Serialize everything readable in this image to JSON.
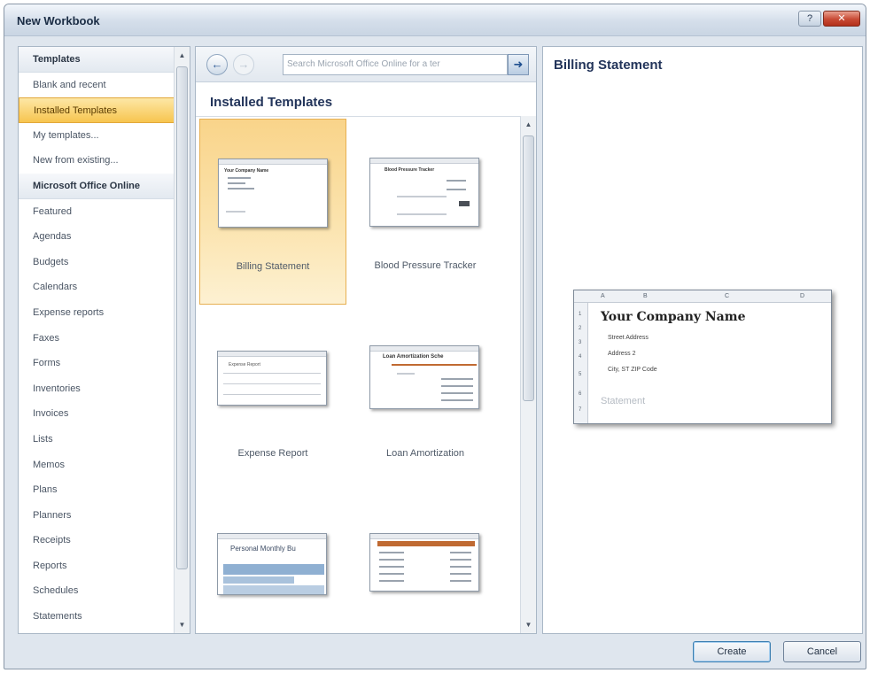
{
  "window": {
    "title": "New Workbook",
    "controls": {
      "help": "?",
      "close": "✕"
    }
  },
  "sidebar": {
    "items": [
      {
        "label": "Templates",
        "kind": "header"
      },
      {
        "label": "Blank and recent",
        "kind": "item"
      },
      {
        "label": "Installed Templates",
        "kind": "selected"
      },
      {
        "label": "My templates...",
        "kind": "item"
      },
      {
        "label": "New from existing...",
        "kind": "item"
      },
      {
        "label": "Microsoft Office Online",
        "kind": "header"
      },
      {
        "label": "Featured",
        "kind": "item"
      },
      {
        "label": "Agendas",
        "kind": "item"
      },
      {
        "label": "Budgets",
        "kind": "item"
      },
      {
        "label": "Calendars",
        "kind": "item"
      },
      {
        "label": "Expense reports",
        "kind": "item"
      },
      {
        "label": "Faxes",
        "kind": "item"
      },
      {
        "label": "Forms",
        "kind": "item"
      },
      {
        "label": "Inventories",
        "kind": "item"
      },
      {
        "label": "Invoices",
        "kind": "item"
      },
      {
        "label": "Lists",
        "kind": "item"
      },
      {
        "label": "Memos",
        "kind": "item"
      },
      {
        "label": "Plans",
        "kind": "item"
      },
      {
        "label": "Planners",
        "kind": "item"
      },
      {
        "label": "Receipts",
        "kind": "item"
      },
      {
        "label": "Reports",
        "kind": "item"
      },
      {
        "label": "Schedules",
        "kind": "item"
      },
      {
        "label": "Statements",
        "kind": "item"
      }
    ]
  },
  "nav": {
    "back_icon": "←",
    "forward_icon": "→",
    "search_placeholder": "Search Microsoft Office Online for a ter",
    "go_icon": "➜"
  },
  "gallery": {
    "title": "Installed Templates",
    "templates": [
      {
        "label": "Billing Statement",
        "thumb_title": "Your Company Name",
        "selected": true
      },
      {
        "label": "Blood Pressure Tracker",
        "thumb_title": "Blood Pressure Tracker",
        "selected": false
      },
      {
        "label": "Expense Report",
        "thumb_title": "Expense Report",
        "selected": false
      },
      {
        "label": "Loan Amortization",
        "thumb_title": "Loan Amortization Sche",
        "selected": false
      },
      {
        "label": "",
        "thumb_title": "Personal Monthly Bu",
        "selected": false
      },
      {
        "label": "",
        "thumb_title": "",
        "selected": false
      }
    ]
  },
  "preview": {
    "title": "Billing Statement",
    "columns": [
      "A",
      "B",
      "C",
      "D"
    ],
    "rows": [
      "1",
      "2",
      "3",
      "4",
      "5",
      "6",
      "7"
    ],
    "company": "Your Company Name",
    "lines": [
      "Street Address",
      "Address 2",
      "City, ST ZIP Code"
    ],
    "statement": "Statement"
  },
  "buttons": {
    "create": "Create",
    "cancel": "Cancel"
  },
  "colors": {
    "selection": "#f7c54f",
    "heading": "#22345a",
    "accent_blue": "#2d5a96"
  }
}
